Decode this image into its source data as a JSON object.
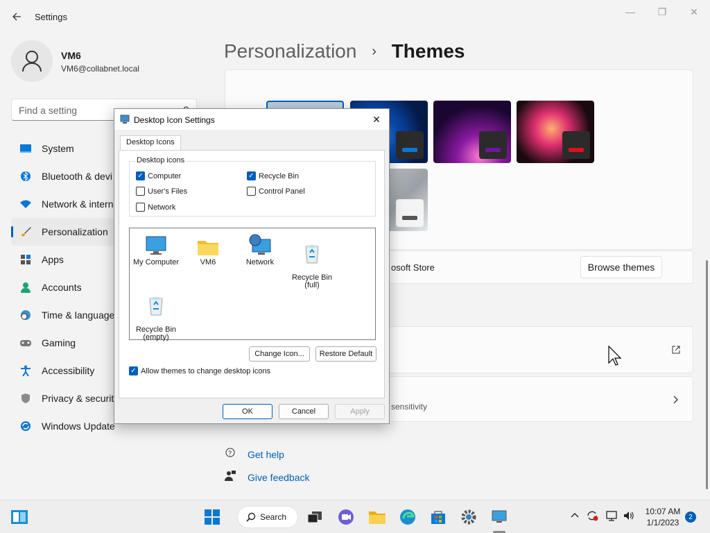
{
  "window": {
    "app_title": "Settings",
    "back_icon": "arrow-left-icon",
    "minimize_glyph": "—",
    "maximize_glyph": "❐",
    "close_glyph": "✕"
  },
  "user": {
    "name": "VM6",
    "email": "VM6@collabnet.local"
  },
  "search": {
    "placeholder": "Find a setting",
    "icon": "⚲"
  },
  "nav": {
    "items": [
      {
        "label": "System",
        "icon": "system-icon",
        "selected": false
      },
      {
        "label": "Bluetooth & devi",
        "icon": "bluetooth-icon",
        "selected": false
      },
      {
        "label": "Network & intern",
        "icon": "wifi-icon",
        "selected": false
      },
      {
        "label": "Personalization",
        "icon": "brush-icon",
        "selected": true
      },
      {
        "label": "Apps",
        "icon": "apps-icon",
        "selected": false
      },
      {
        "label": "Accounts",
        "icon": "person-icon",
        "selected": false
      },
      {
        "label": "Time & language",
        "icon": "clock-globe-icon",
        "selected": false
      },
      {
        "label": "Gaming",
        "icon": "gamepad-icon",
        "selected": false
      },
      {
        "label": "Accessibility",
        "icon": "accessibility-icon",
        "selected": false
      },
      {
        "label": "Privacy & security",
        "icon": "shield-icon",
        "selected": false
      },
      {
        "label": "Windows Update",
        "icon": "update-icon",
        "selected": false
      }
    ]
  },
  "breadcrumb": {
    "parent": "Personalization",
    "separator": "›",
    "current": "Themes"
  },
  "themes": {
    "store_text": "osoft Store",
    "browse_label": "Browse themes",
    "sensitivity_text": "sensitivity",
    "colors": {
      "accent_blue": "#0a78d4",
      "accent_purple": "#6a1a9a",
      "accent_red": "#e0101a",
      "accent_grey": "#555555"
    }
  },
  "help": {
    "get_help": "Get help",
    "give_feedback": "Give feedback"
  },
  "dialog": {
    "title": "Desktop Icon Settings",
    "close_glyph": "✕",
    "tab": "Desktop Icons",
    "group_label": "Desktop icons",
    "checkboxes": {
      "computer": {
        "label": "Computer",
        "checked": true
      },
      "recycle_bin": {
        "label": "Recycle Bin",
        "checked": true
      },
      "users_files": {
        "label": "User's Files",
        "checked": false
      },
      "control_panel": {
        "label": "Control Panel",
        "checked": false
      },
      "network": {
        "label": "Network",
        "checked": false
      }
    },
    "icons": {
      "my_computer": "My Computer",
      "vm6": "VM6",
      "network": "Network",
      "recycle_full": "Recycle Bin\n(full)",
      "recycle_empty": "Recycle Bin\n(empty)"
    },
    "change_icon": "Change Icon...",
    "restore_default": "Restore Default",
    "allow_themes": {
      "label": "Allow themes to change desktop icons",
      "checked": true
    },
    "ok": "OK",
    "cancel": "Cancel",
    "apply": "Apply"
  },
  "taskbar": {
    "search_label": "Search",
    "time": "10:07 AM",
    "date": "1/1/2023",
    "notification_count": "2"
  },
  "checkmark": "✓"
}
